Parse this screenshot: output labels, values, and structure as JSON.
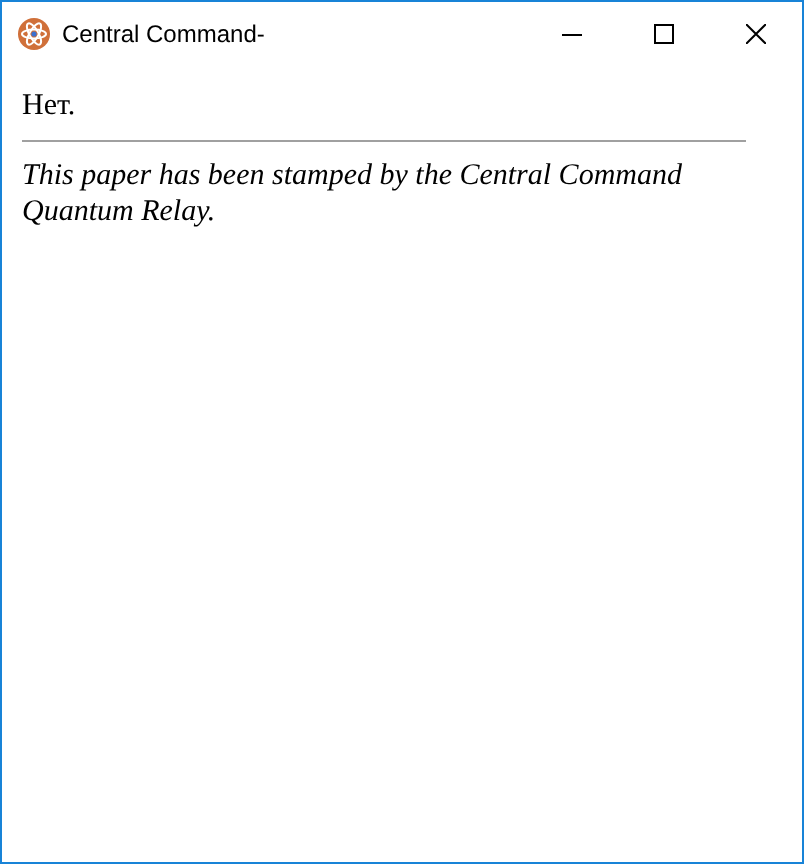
{
  "window": {
    "title": "Central Command-"
  },
  "paper": {
    "body": "Нет.",
    "stamp": "This paper has been stamped by the Central Command Quantum Relay."
  }
}
